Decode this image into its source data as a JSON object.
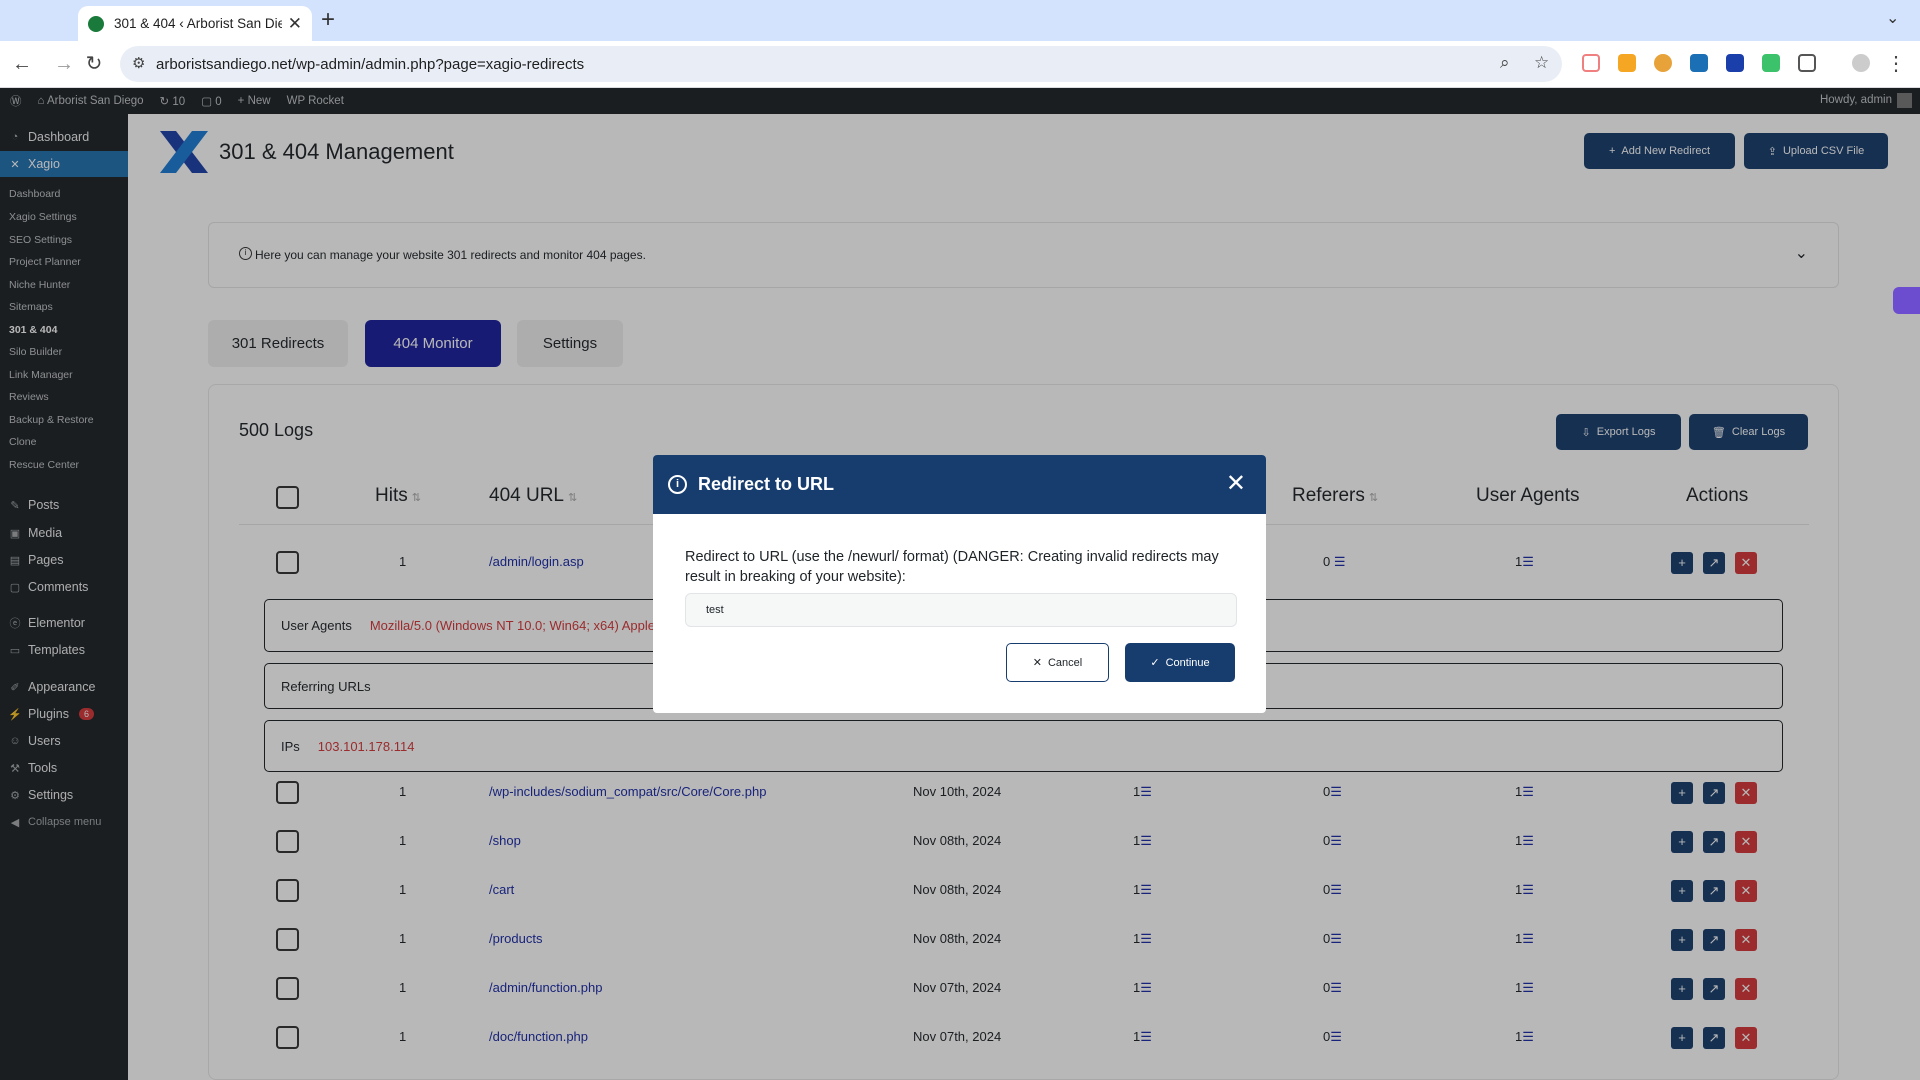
{
  "browser": {
    "tab_title": "301 & 404 ‹ Arborist San Die",
    "url": "arboristsandiego.net/wp-admin/admin.php?page=xagio-redirects"
  },
  "adminbar": {
    "site": "Arborist San Diego",
    "updates": "10",
    "comments": "0",
    "new": "New",
    "rocket": "WP Rocket",
    "howdy": "Howdy, admin"
  },
  "sidebar": {
    "top": [
      {
        "label": "Dashboard"
      },
      {
        "label": "Xagio"
      }
    ],
    "sub": [
      "Dashboard",
      "Xagio Settings",
      "SEO Settings",
      "Project Planner",
      "Niche Hunter",
      "Sitemaps",
      "301 & 404",
      "Silo Builder",
      "Link Manager",
      "Reviews",
      "Backup & Restore",
      "Clone",
      "Rescue Center"
    ],
    "bottom": [
      "Posts",
      "Media",
      "Pages",
      "Comments",
      "Elementor",
      "Templates",
      "Appearance",
      "Plugins",
      "Users",
      "Tools",
      "Settings",
      "Collapse menu"
    ],
    "plugins_badge": "6"
  },
  "page": {
    "title": "301 & 404 Management",
    "add_btn": "Add New Redirect",
    "upload_btn": "Upload CSV File",
    "info": "Here you can manage your website 301 redirects and monitor 404 pages.",
    "tabs": [
      "301 Redirects",
      "404 Monitor",
      "Settings"
    ],
    "logs_count": "500 Logs",
    "export": "Export Logs",
    "clear": "Clear Logs",
    "headers": {
      "hits": "Hits",
      "url": "404 URL",
      "referers": "Referers",
      "agents": "User Agents",
      "actions": "Actions"
    }
  },
  "expanded": {
    "hits": "1",
    "url": "/admin/login.asp",
    "referers": "0",
    "agents": "1",
    "agents_label": "User Agents",
    "agents_value": "Mozilla/5.0 (Windows NT 10.0; Win64; x64) AppleW",
    "ref_label": "Referring URLs",
    "ips_label": "IPs",
    "ips_value": "103.101.178.114"
  },
  "rows": [
    {
      "hits": "1",
      "url": "/wp-includes/sodium_compat/src/Core/Core.php",
      "date": "Nov 10th, 2024",
      "count": "1",
      "ref": "0",
      "agents": "1"
    },
    {
      "hits": "1",
      "url": "/shop",
      "date": "Nov 08th, 2024",
      "count": "1",
      "ref": "0",
      "agents": "1"
    },
    {
      "hits": "1",
      "url": "/cart",
      "date": "Nov 08th, 2024",
      "count": "1",
      "ref": "0",
      "agents": "1"
    },
    {
      "hits": "1",
      "url": "/products",
      "date": "Nov 08th, 2024",
      "count": "1",
      "ref": "0",
      "agents": "1"
    },
    {
      "hits": "1",
      "url": "/admin/function.php",
      "date": "Nov 07th, 2024",
      "count": "1",
      "ref": "0",
      "agents": "1"
    },
    {
      "hits": "1",
      "url": "/doc/function.php",
      "date": "Nov 07th, 2024",
      "count": "1",
      "ref": "0",
      "agents": "1"
    }
  ],
  "modal": {
    "title": "Redirect to URL",
    "body": "Redirect to URL (use the /newurl/ format) (DANGER: Creating invalid redirects may result in breaking of your website):",
    "input": "test",
    "cancel": "Cancel",
    "continue": "Continue"
  }
}
